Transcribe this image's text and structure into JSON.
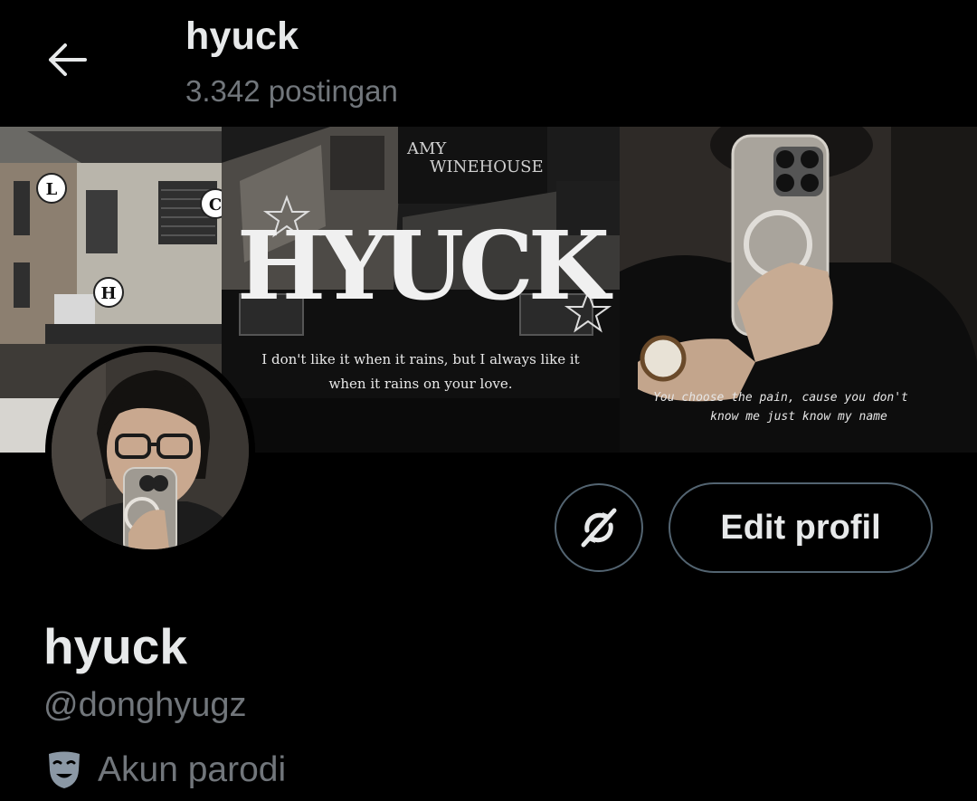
{
  "header": {
    "title": "hyuck",
    "post_count": "3.342 postingan",
    "back_icon": "arrow-left-icon"
  },
  "banner": {
    "letters": [
      "L",
      "C",
      "H"
    ],
    "album_text_line1": "AMY",
    "album_text_line2": "WINEHOUSE",
    "logo_text": "HYUCK",
    "quote_line1": "I don't like it when it rains, but I always like it",
    "quote_line2": "when it rains on your love.",
    "lyric_line1": "You choose the pain, cause you don't",
    "lyric_line2": "know me just know my name"
  },
  "profile": {
    "display_name": "hyuck",
    "handle": "@donghyugz",
    "parody_label": "Akun parodi",
    "parody_icon": "theater-mask-icon"
  },
  "actions": {
    "edit_label": "Edit profil",
    "icon_button_icon": "no-sync-icon"
  },
  "colors": {
    "background": "#000000",
    "primary_text": "#e7e9ea",
    "secondary_text": "#71767b",
    "border": "#536471",
    "parody_icon": "#8b98a5"
  }
}
